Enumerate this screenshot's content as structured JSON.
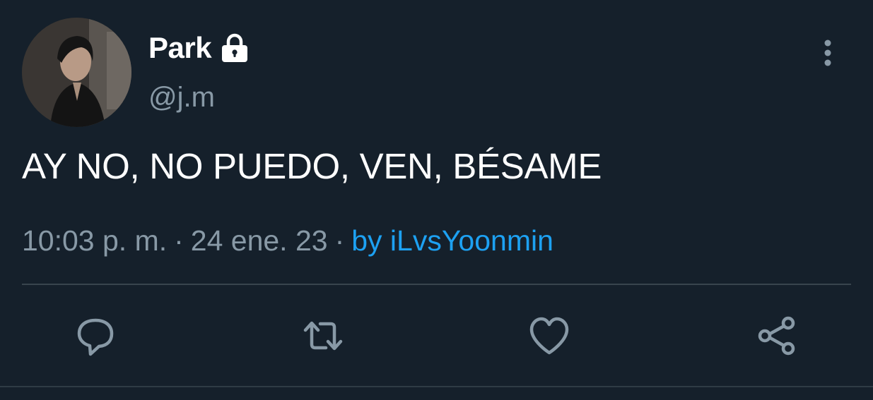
{
  "author": {
    "display_name": "Park",
    "handle": "@j.m",
    "avatar": "avatar-photo",
    "protected_icon": "lock-icon"
  },
  "tweet": {
    "text": "AY NO, NO PUEDO, VEN, BÉSAME",
    "time": "10:03 p. m.",
    "date": "24 ene. 23",
    "separator": "·",
    "source": "by iLvsYoonmin"
  },
  "actions": {
    "reply_icon": "reply-icon",
    "retweet_icon": "retweet-icon",
    "like_icon": "heart-icon",
    "share_icon": "share-icon",
    "more_icon": "more-vertical-icon"
  },
  "colors": {
    "background": "#15202b",
    "primary_text": "#ffffff",
    "secondary_text": "#8899a6",
    "link": "#1da1f2",
    "divider": "#38444d"
  }
}
